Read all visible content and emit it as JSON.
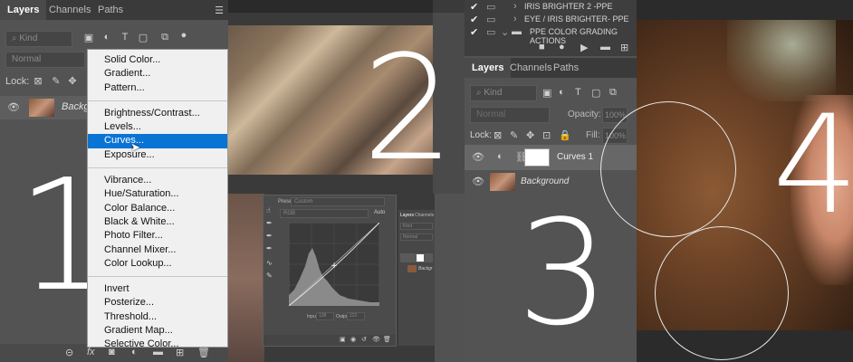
{
  "panel1": {
    "tabs": [
      "Layers",
      "Channels",
      "Paths"
    ],
    "kind_label": "Kind",
    "blend_mode": "Normal",
    "lock_label": "Lock:",
    "layer_name": "Background",
    "big_number": "1"
  },
  "adjust_menu": {
    "group1": [
      "Solid Color...",
      "Gradient...",
      "Pattern..."
    ],
    "group2": [
      "Brightness/Contrast...",
      "Levels...",
      "Curves...",
      "Exposure..."
    ],
    "group3": [
      "Vibrance...",
      "Hue/Saturation...",
      "Color Balance...",
      "Black & White...",
      "Photo Filter...",
      "Channel Mixer...",
      "Color Lookup..."
    ],
    "group4": [
      "Invert",
      "Posterize...",
      "Threshold...",
      "Gradient Map...",
      "Selective Color..."
    ],
    "highlighted": "Curves..."
  },
  "panel2": {
    "big_number": "2"
  },
  "curves_dialog": {
    "preset_label": "Preset:",
    "preset_value": "Custom",
    "channel_value": "RGB",
    "auto_label": "Auto",
    "input_label": "Input:",
    "input_value": "128",
    "output_label": "Output:",
    "output_value": "122"
  },
  "mini_layers": {
    "tabs": [
      "Layers",
      "Channels"
    ],
    "kind": "Kind",
    "mode": "Normal",
    "layer_name": "Backgr"
  },
  "panel3": {
    "actions": [
      "IRIS BRIGHTER 2 -PPE",
      "EYE / IRIS BRIGHTER- PPE",
      "PPE COLOR GRADING ACTIONS"
    ],
    "tabs": [
      "Layers",
      "Channels",
      "Paths"
    ],
    "kind_label": "Kind",
    "blend_mode": "Normal",
    "opacity_label": "Opacity:",
    "opacity_value": "100%",
    "lock_label": "Lock:",
    "fill_label": "Fill:",
    "fill_value": "100%",
    "layers": [
      "Curves 1",
      "Background"
    ],
    "big_number": "3"
  },
  "panel4": {
    "big_number": "4"
  }
}
